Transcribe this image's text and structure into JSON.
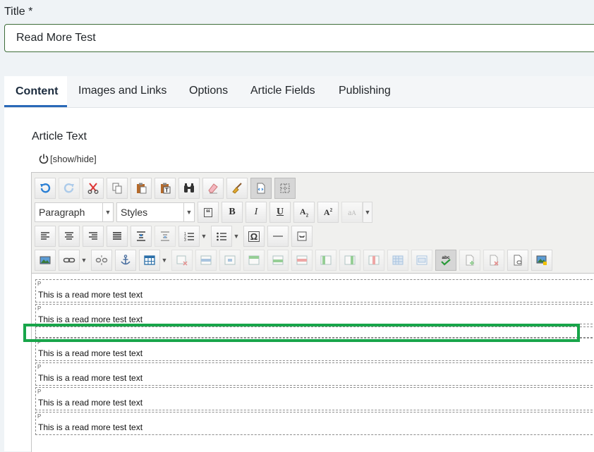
{
  "title_field": {
    "label": "Title *",
    "value": "Read More Test"
  },
  "tabs": [
    {
      "label": "Content",
      "active": true
    },
    {
      "label": "Images and Links",
      "active": false
    },
    {
      "label": "Options",
      "active": false
    },
    {
      "label": "Article Fields",
      "active": false
    },
    {
      "label": "Publishing",
      "active": false
    }
  ],
  "editor": {
    "label": "Article Text",
    "toggle_label": "[show/hide]",
    "format_select": "Paragraph",
    "styles_select": "Styles",
    "paragraphs": [
      {
        "tag": "P",
        "text": "This is a read more test text"
      },
      {
        "tag": "P",
        "text": "This is a read more test text"
      },
      {
        "tag": "",
        "text": ""
      },
      {
        "tag": "P",
        "text": "This is a read more test text"
      },
      {
        "tag": "P",
        "text": "This is a read more test text"
      },
      {
        "tag": "P",
        "text": "This is a read more test text"
      },
      {
        "tag": "P",
        "text": "This is a read more test text"
      }
    ]
  },
  "colors": {
    "highlight": "#18a54a",
    "tab_active": "#2a69b8",
    "input_border": "#3e6d3a"
  }
}
